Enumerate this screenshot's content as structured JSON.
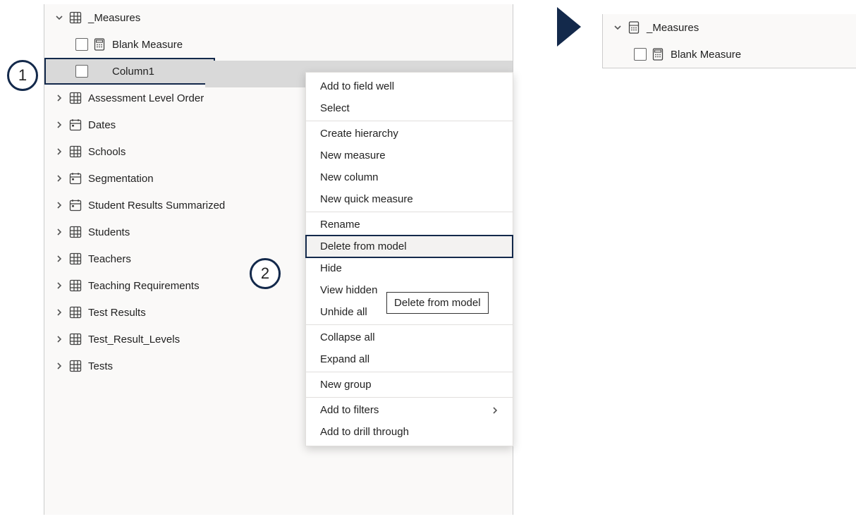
{
  "badge": {
    "one": "1",
    "two": "2"
  },
  "left_tree": {
    "root": "_Measures",
    "blank_measure": "Blank Measure",
    "column1": "Column1",
    "items": [
      "Assessment Level Order",
      "Dates",
      "Schools",
      "Segmentation",
      "Student Results Summarized",
      "Students",
      "Teachers",
      "Teaching Requirements",
      "Test Results",
      "Test_Result_Levels",
      "Tests"
    ]
  },
  "context_menu": {
    "items": [
      "Add to field well",
      "Select",
      "Create hierarchy",
      "New measure",
      "New column",
      "New quick measure",
      "Rename",
      "Delete from model",
      "Hide",
      "View hidden",
      "Unhide all",
      "Collapse all",
      "Expand all",
      "New group",
      "Add to filters",
      "Add to drill through"
    ],
    "tooltip": "Delete from model"
  },
  "right_tree": {
    "root": "_Measures",
    "blank_measure": "Blank Measure"
  }
}
